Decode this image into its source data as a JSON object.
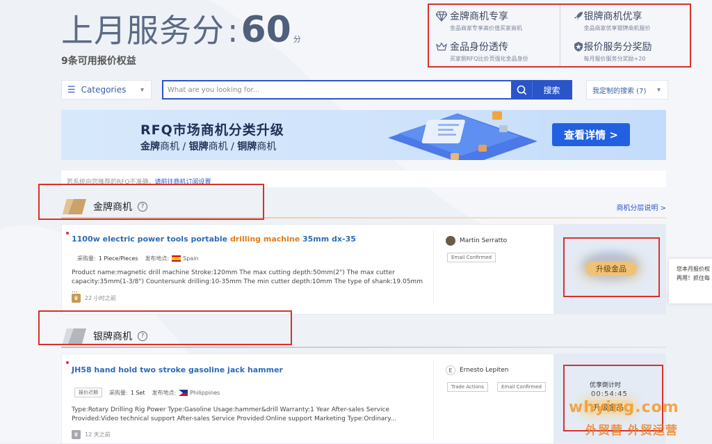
{
  "header": {
    "score_label": "上月服务分",
    "score_value": "60",
    "score_unit": "分",
    "sub_line": "9条可用报价权益"
  },
  "benefits": [
    {
      "icon": "diamond-icon",
      "title": "金牌商机专享",
      "sub": "金品商家专享高价值买家商机"
    },
    {
      "icon": "rocket-icon",
      "title": "银牌商机优享",
      "sub": "金品商家优享银牌商机报价"
    },
    {
      "icon": "crown-icon",
      "title": "金品身份透传",
      "sub": "买家侧RFQ比价页强化金品身份"
    },
    {
      "icon": "shield-star-icon",
      "title": "报价服务分奖励",
      "sub": "每月报价服务分奖励+20"
    }
  ],
  "search": {
    "categories_label": "Categories",
    "placeholder": "What are you looking for...",
    "button_label": "搜索",
    "my_search_label": "我定制的搜索 (7)"
  },
  "banner": {
    "title": "RFQ市场商机分类升级",
    "sub_gold": "金牌",
    "sub_gold_suffix": "商机 / ",
    "sub_silver": "银牌",
    "sub_silver_suffix": "商机 / ",
    "sub_bronze": "铜牌",
    "sub_bronze_suffix": "商机",
    "button_label": "查看详情 >"
  },
  "notice": {
    "text": "若系统向您推荐的RFQ不准确，",
    "link": "请前往商机订阅设置"
  },
  "gold_section": {
    "title": "金牌商机",
    "help": "?",
    "right_link": "商机分层说明 >"
  },
  "silver_section": {
    "title": "银牌商机",
    "help": "?"
  },
  "gold_card": {
    "title_pre": "1100w electric power tools portable ",
    "title_hl": "drilling machine",
    "title_post": " 35mm dx-35",
    "qty_label": "采购量:",
    "qty_value": "1 Piece/Pieces",
    "loc_label": "发布地点:",
    "loc_value": "Spain",
    "desc": "Product name:magnetic drill machine Stroke:120mm The max cutting depth:50mm(2\") The max cutter capacity:35mm(1-3/8\") Countersunk drilling:10-35mm The min cutter depth:10mm The type of shank:19.05mm ...",
    "time": "22 小时之前",
    "buyer": "Martin Serratto",
    "tags": [
      "Email Confirmed"
    ],
    "cta": "升级金品"
  },
  "silver_card": {
    "title": "JH58 hand hold two stroke gasoline jack hammer",
    "status_tag": "报价迟期",
    "qty_label": "采购量:",
    "qty_value": "1 Set",
    "loc_label": "发布地点:",
    "loc_value": "Philippines",
    "desc": "Type:Rotary Drilling Rig Power Type:Gasoline Usage:hammer&drill Warranty:1 Year After-sales Service Provided:Video technical support After-sales Service Provided:Online support Marketing Type:Ordinary...",
    "time": "12 天之前",
    "buyer_initial": "E",
    "buyer": "Ernesto Lepiten",
    "tags": [
      "Trade Actions",
      "Email Confirmed"
    ],
    "countdown_label": "优享倒计时",
    "countdown_value": "00:54:45",
    "cta": "升级金品"
  },
  "side_tip": {
    "line1": "您本月报价权",
    "line2": "再用！抓住每"
  },
  "watermark": {
    "line1": "whying.com",
    "line2": "外贸营 外贸运营"
  },
  "colors": {
    "accent_blue": "#2a55c9",
    "highlight_orange": "#e27b1c",
    "annotation_red": "#d9302c",
    "gold": "#efc27a"
  }
}
